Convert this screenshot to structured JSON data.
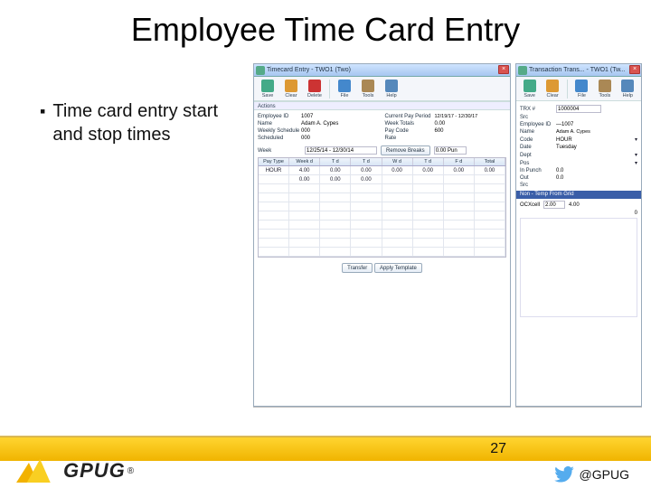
{
  "title": "Employee Time Card Entry",
  "bullet": "Time card entry start and stop times",
  "win1": {
    "title": "Timecard Entry - TWO1 (Two)",
    "toolbar": [
      "Save",
      "Clear",
      "Delete",
      "",
      "File",
      "Tools",
      "Help"
    ],
    "tabs": "Actions",
    "form": {
      "emp_id_lbl": "Employee ID",
      "emp_id": "1007",
      "name_lbl": "Name",
      "name": "Adam A. Cypes",
      "week_lbl": "Weekly Schedule",
      "week": "000",
      "sched_lbl": "Scheduled",
      "sched": "000",
      "period_lbl": "Current Pay Period",
      "period": "12/19/17 - 12/30/17",
      "week_total_lbl": "Week Totals",
      "week_total": "0.00",
      "pcode_lbl": "Pay Code",
      "pcode": "600",
      "rate_lbl": "Rate",
      "rate": "",
      "week_sel_lbl": "Week",
      "week_sel": "12/25/14 - 12/30/14",
      "remove_btn": "Remove Breaks",
      "hint": "0.00 Pun"
    },
    "grid": {
      "headers": [
        "Pay Type",
        "Week d",
        "T d",
        "T d",
        "W d",
        "T d",
        "F d",
        "Total"
      ],
      "rows": [
        [
          "HOUR",
          "4.00",
          "0.00",
          "0.00",
          "0.00",
          "0.00",
          "0.00",
          "0.00"
        ],
        [
          "",
          "0.00",
          "0.00",
          "0.00",
          "",
          "",
          "",
          ""
        ]
      ],
      "empty_rows": 8
    },
    "footer": {
      "btn1": "Transfer",
      "btn2": "Apply Template"
    }
  },
  "win2": {
    "title": "Transaction Trans... - TWO1 (Tw...",
    "toolbar": [
      "Save",
      "Clear",
      "",
      "File",
      "Tools",
      "Help"
    ],
    "form": {
      "trx_lbl": "TRX #",
      "trx": "1000004",
      "src_lbl": "Src",
      "emp_lbl": "Employee ID",
      "emp": "—1007",
      "name_lbl": "Name",
      "name": "Adam A. Cypes",
      "code_lbl": "Code",
      "code": "HOUR",
      "date_lbl": "Date",
      "date": "Tuesday",
      "dept_lbl": "Dept",
      "dept": "",
      "pos_lbl": "Pos",
      "pos": "",
      "in_lbl": "In Punch",
      "in": "0.0",
      "out_lbl": "Out",
      "out": "0.0",
      "src2_lbl": "Src"
    },
    "section": {
      "title": "Non - Temp From Grid",
      "row_lbl": "OCXcell",
      "row_val1": "2.00",
      "row_val2": "4.00",
      "row_val3": "0"
    }
  },
  "footer": {
    "page": "27",
    "logo": "GPUG",
    "reg": "®",
    "handle": "@GPUG"
  }
}
